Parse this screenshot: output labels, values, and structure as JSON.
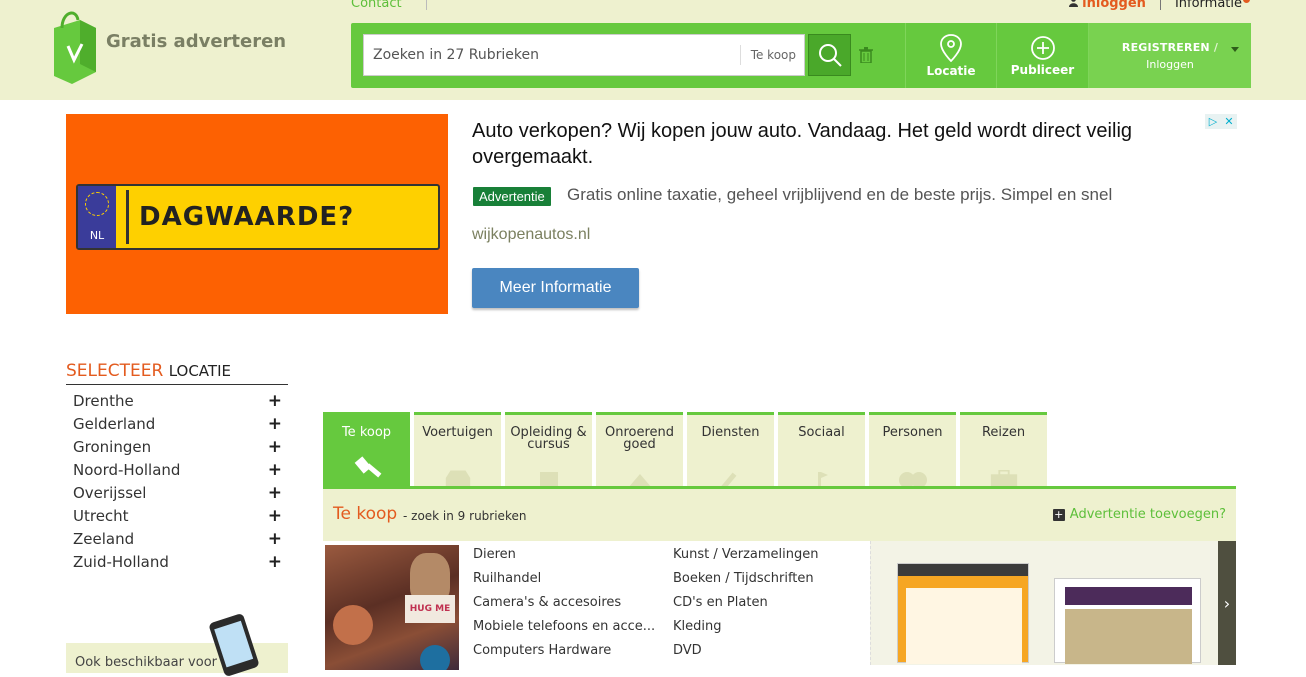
{
  "header": {
    "logo_text": "Gratis adverteren",
    "top_links": {
      "contact": "Contact"
    },
    "top_right": {
      "login": "inloggen",
      "info": "Informatie"
    },
    "search": {
      "placeholder": "Zoeken in 27 Rubrieken",
      "category": "Te koop"
    },
    "actions": {
      "location": "Locatie",
      "publish": "Publiceer",
      "register": "REGISTREREN",
      "register_sep": "/",
      "login": "Inloggen"
    }
  },
  "ad": {
    "plate_country": "NL",
    "plate_text": "DAGWAARDE?",
    "title": "Auto verkopen? Wij kopen jouw auto. Vandaag. Het geld wordt direct veilig overgemaakt.",
    "badge": "Advertentie",
    "description": "Gratis online taxatie, geheel vrijblijvend en de beste prijs. Simpel en snel",
    "domain": "wijkopenautos.nl",
    "button": "Meer Informatie"
  },
  "location": {
    "title_highlight": "SELECTEER",
    "title_rest": "LOCATIE",
    "provinces": [
      "Drenthe",
      "Gelderland",
      "Groningen",
      "Noord-Holland",
      "Overijssel",
      "Utrecht",
      "Zeeland",
      "Zuid-Holland"
    ],
    "app_text": "Ook beschikbaar voor"
  },
  "tabs": [
    {
      "label": "Te koop",
      "icon": "gavel-icon",
      "active": true
    },
    {
      "label": "Voertuigen",
      "icon": "car-icon"
    },
    {
      "label": "Opleiding & cursus",
      "icon": "book-icon"
    },
    {
      "label": "Onroerend goed",
      "icon": "house-icon"
    },
    {
      "label": "Diensten",
      "icon": "wrench-icon"
    },
    {
      "label": "Sociaal",
      "icon": "music-icon"
    },
    {
      "label": "Personen",
      "icon": "heart-icon"
    },
    {
      "label": "Reizen",
      "icon": "suitcase-icon"
    }
  ],
  "category": {
    "title": "Te koop",
    "subtitle": "- zoek in 9 rubrieken",
    "add": "Advertentie toevoegen?",
    "image_text": "HUG ME",
    "col1": [
      "Dieren",
      "Ruilhandel",
      "Camera's & accesoires",
      "Mobiele telefoons en acce...",
      "Computers Hardware"
    ],
    "col2": [
      "Kunst / Verzamelingen",
      "Boeken / Tijdschriften",
      "CD's en Platen",
      "Kleding",
      "DVD"
    ]
  },
  "colors": {
    "green": "#66c93e",
    "cream": "#eef1cf",
    "orange": "#e35b1f",
    "ad_orange": "#fd6102",
    "ad_button": "#4a86c0"
  }
}
